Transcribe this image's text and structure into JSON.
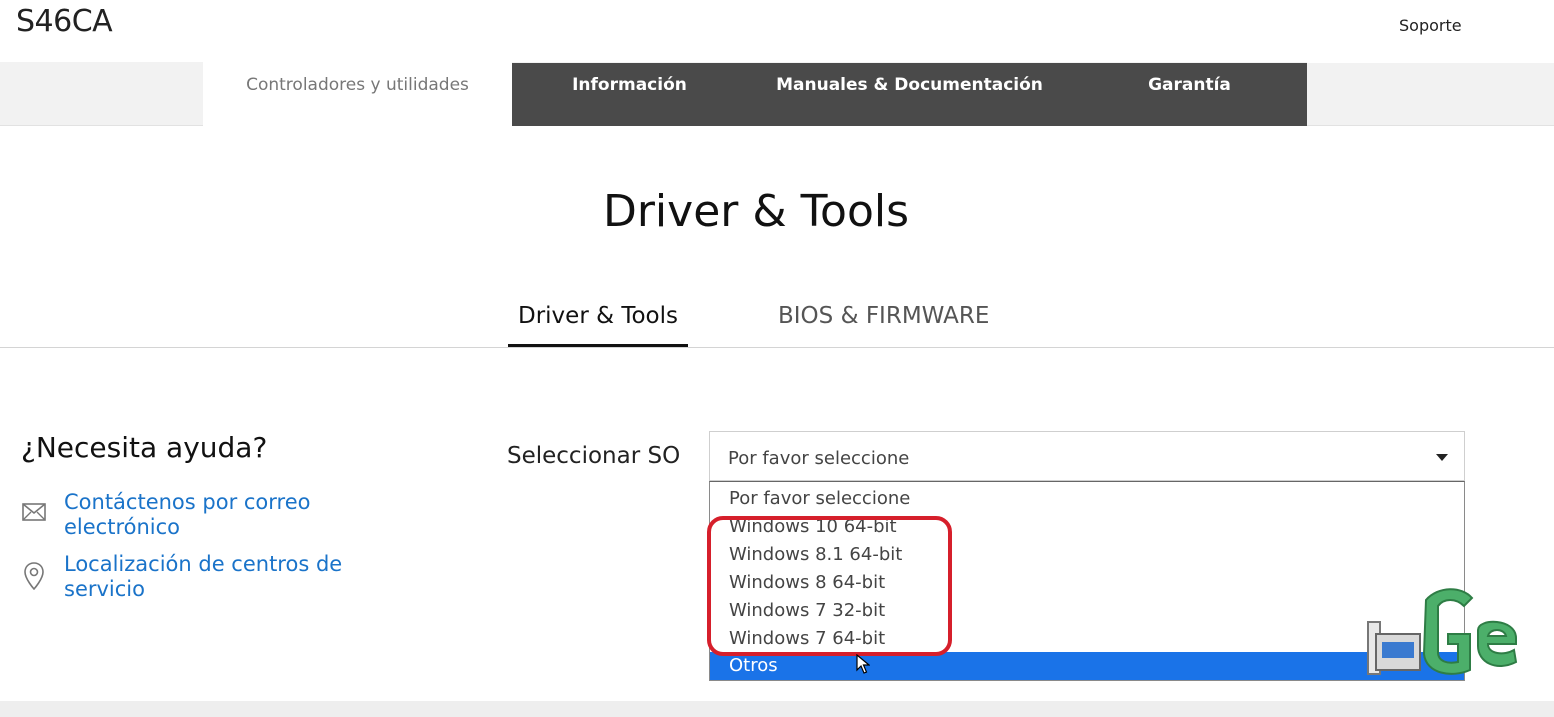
{
  "header": {
    "product_title": "S46CA",
    "support_label": "Soporte"
  },
  "nav": {
    "active_tab": "Controladores y utilidades",
    "tabs": [
      "Información",
      "Manuales & Documentación",
      "Garantía"
    ]
  },
  "page": {
    "heading": "Driver & Tools",
    "subtabs": [
      "Driver & Tools",
      "BIOS & FIRMWARE"
    ]
  },
  "help": {
    "title": "¿Necesita ayuda?",
    "email_link": "Contáctenos por correo electrónico",
    "service_link": "Localización de centros de servicio"
  },
  "os_select": {
    "label": "Seleccionar SO",
    "value": "Por favor seleccione",
    "options": [
      "Por favor seleccione",
      "Windows 10 64-bit",
      "Windows 8.1 64-bit",
      "Windows 8 64-bit",
      "Windows 7 32-bit",
      "Windows 7 64-bit",
      "Otros"
    ],
    "highlighted_option": "Otros"
  },
  "colors": {
    "nav_dark": "#4a4a4a",
    "link": "#1a73c9",
    "selected_option": "#1a73e8",
    "highlight_outline": "#d61f2b",
    "watermark_green": "#4caf6a"
  },
  "icons": [
    "mail-icon",
    "location-pin-icon",
    "dropdown-caret-icon",
    "mouse-cursor-icon"
  ]
}
